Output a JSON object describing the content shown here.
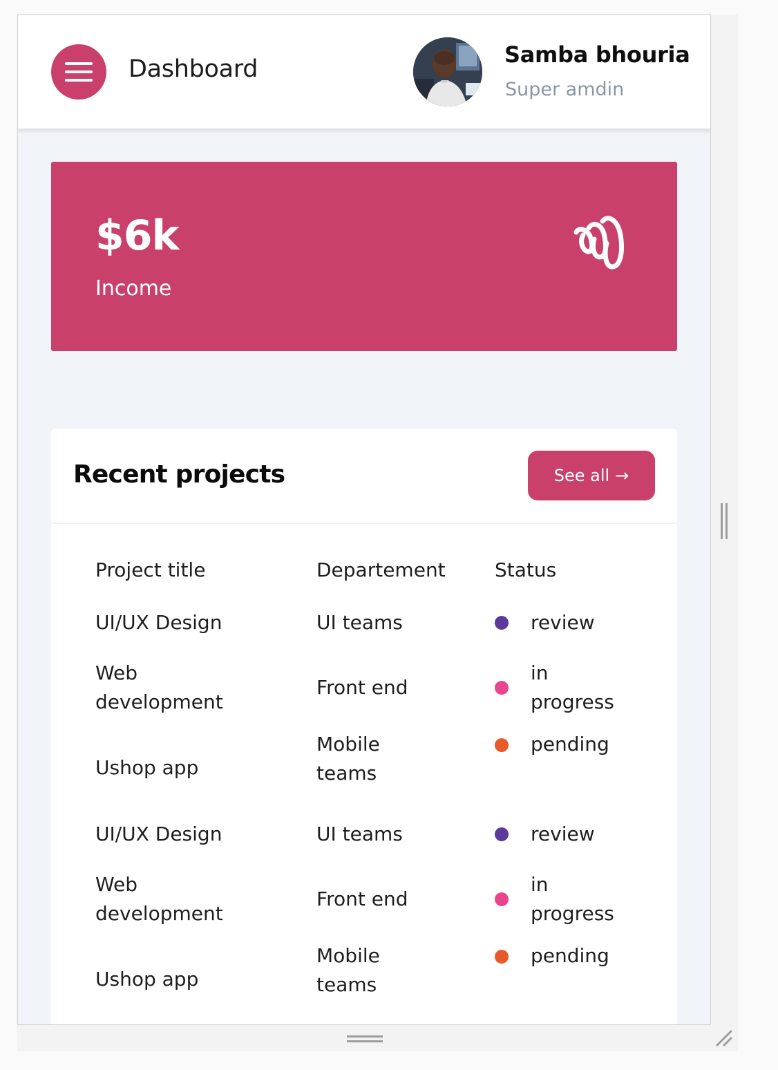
{
  "header": {
    "title": "Dashboard",
    "user_name": "Samba bhouria",
    "user_role": "Super amdin"
  },
  "income": {
    "amount": "$6k",
    "label": "Income"
  },
  "projects": {
    "title": "Recent projects",
    "see_all_label": "See all",
    "columns": [
      "Project title",
      "Departement",
      "Status"
    ],
    "rows": [
      {
        "title": "UI/UX Design",
        "department": "UI teams",
        "status": "review",
        "status_color": "#5b3a9a"
      },
      {
        "title": "Web development",
        "department": "Front end",
        "status": "in progress",
        "status_color": "#e8458e"
      },
      {
        "title": "Ushop app",
        "department": "Mobile teams",
        "status": "pending",
        "status_color": "#e85a2a"
      },
      {
        "title": "UI/UX Design",
        "department": "UI teams",
        "status": "review",
        "status_color": "#5b3a9a"
      },
      {
        "title": "Web development",
        "department": "Front end",
        "status": "in progress",
        "status_color": "#e8458e"
      },
      {
        "title": "Ushop app",
        "department": "Mobile teams",
        "status": "pending",
        "status_color": "#e85a2a"
      }
    ]
  },
  "colors": {
    "accent": "#c9416b",
    "background": "#f1f4f9"
  },
  "icons": {
    "menu": "hamburger-menu-icon",
    "income": "wave-scribble-icon",
    "arrow": "arrow-right-icon"
  }
}
